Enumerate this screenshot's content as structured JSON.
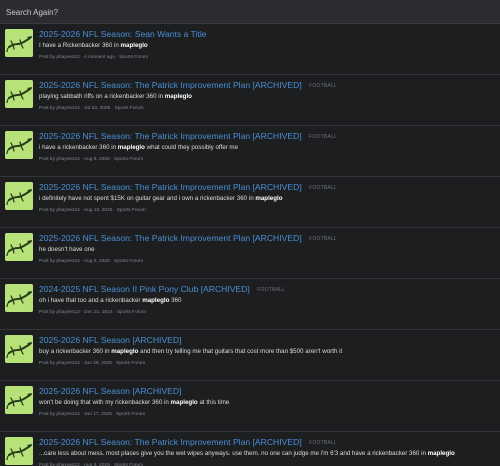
{
  "search": {
    "placeholder": "Search Again?"
  },
  "results": [
    {
      "title": "2025-2026 NFL Season: Sean Wants a Title",
      "tag": "",
      "snippet_before": "I have a Rickenbacker 360 in ",
      "snippet_bold": "mapleglo",
      "snippet_after": "",
      "author": "phaynes12",
      "date": "A moment ago",
      "forum": "Sports Forum"
    },
    {
      "title": "2025-2026 NFL Season: The Patrick Improvement Plan [ARCHIVED]",
      "tag": "FOOTBALL",
      "snippet_before": "playing sabbath riffs on a rickenbacker 360 in ",
      "snippet_bold": "mapleglo",
      "snippet_after": "",
      "author": "phaynes12",
      "date": "Jul 23, 2025",
      "forum": "Sports Forum"
    },
    {
      "title": "2025-2026 NFL Season: The Patrick Improvement Plan [ARCHIVED]",
      "tag": "FOOTBALL",
      "snippet_before": "i have a rickenbacker 360 in ",
      "snippet_bold": "mapleglo",
      "snippet_after": " what could they possibly offer me",
      "author": "phaynes12",
      "date": "Aug 6, 2025",
      "forum": "Sports Forum"
    },
    {
      "title": "2025-2026 NFL Season: The Patrick Improvement Plan [ARCHIVED]",
      "tag": "FOOTBALL",
      "snippet_before": "i definitely have not spent $15K on guitar gear and i own a rickenbacker 360 in ",
      "snippet_bold": "mapleglo",
      "snippet_after": "",
      "author": "phaynes12",
      "date": "Aug 13, 2025",
      "forum": "Sports Forum"
    },
    {
      "title": "2025-2026 NFL Season: The Patrick Improvement Plan [ARCHIVED]",
      "tag": "FOOTBALL",
      "snippet_before": "he doesn't have one",
      "snippet_bold": "",
      "snippet_after": "",
      "author": "phaynes12",
      "date": "Aug 6, 2025",
      "forum": "Sports Forum"
    },
    {
      "title": "2024-2025 NFL Season II Pink Pony Club [ARCHIVED]",
      "tag": "FOOTBALL",
      "snippet_before": "oh i have that too and a rickenbacker ",
      "snippet_bold": "mapleglo",
      "snippet_after": " 360",
      "author": "phaynes12",
      "date": "Dec 31, 2024",
      "forum": "Sports Forum"
    },
    {
      "title": "2025-2026 NFL Season [ARCHIVED]",
      "tag": "",
      "snippet_before": "buy a rickenbacker 360 in ",
      "snippet_bold": "mapleglo",
      "snippet_after": " and then try telling me that guitars that cost more than $500 aren't worth it",
      "author": "phaynes12",
      "date": "Jun 29, 2025",
      "forum": "Sports Forum"
    },
    {
      "title": "2025-2026 NFL Season [ARCHIVED]",
      "tag": "",
      "snippet_before": "won't be doing that with my rickenbacker 360 in ",
      "snippet_bold": "mapleglo",
      "snippet_after": " at this time",
      "author": "phaynes12",
      "date": "Jun 17, 2025",
      "forum": "Sports Forum"
    },
    {
      "title": "2025-2026 NFL Season: The Patrick Improvement Plan [ARCHIVED]",
      "tag": "FOOTBALL",
      "snippet_before": "...care less about mess. most places give you the wet wipes anyways. use them. no one can judge me i'm 6'3 and have a rickenbacker 360 in ",
      "snippet_bold": "mapleglo",
      "snippet_after": "",
      "author": "phaynes12",
      "date": "Aug 6, 2025",
      "forum": "Sports Forum"
    }
  ],
  "meta_prefix": "Post by",
  "meta_separator": "·",
  "colors": {
    "background": "#1d1e20",
    "title_link": "#4a8fd6",
    "avatar_bg": "#b7e27a"
  },
  "icons": {
    "avatar": "lizard-avatar-icon"
  }
}
